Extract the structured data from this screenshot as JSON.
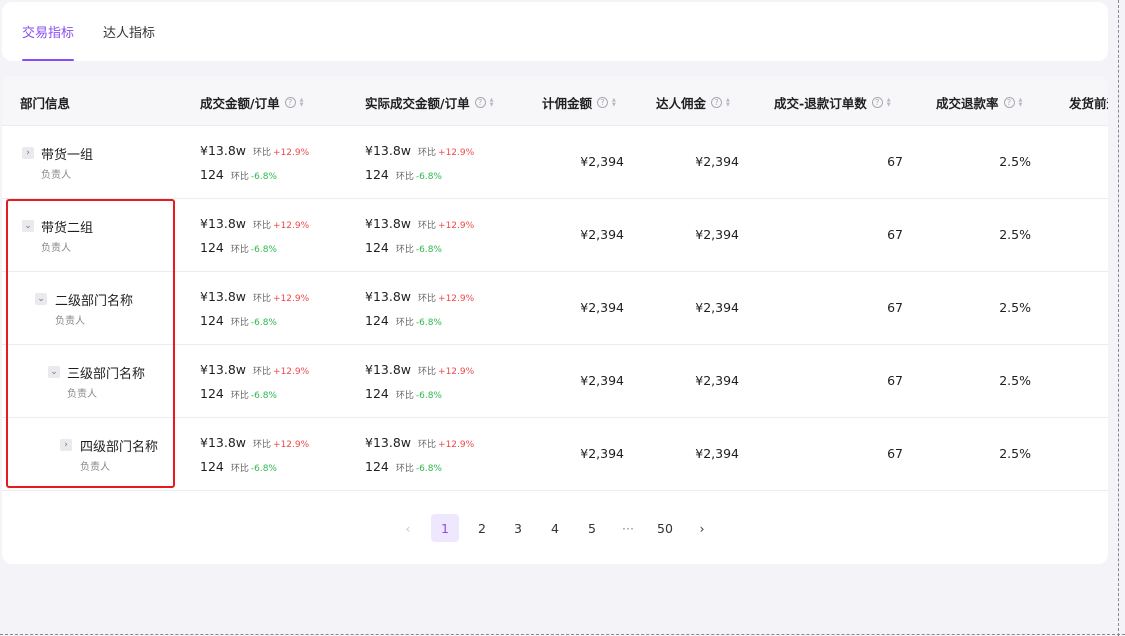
{
  "tabs": [
    {
      "label": "交易指标",
      "active": true
    },
    {
      "label": "达人指标",
      "active": false
    }
  ],
  "colors": {
    "accent": "#8a4df0",
    "up": "#f04848",
    "down": "#2db84d",
    "highlight": "#e8191f"
  },
  "columns": {
    "dept": "部门信息",
    "gmv_orders": "成交金额/订单",
    "actual_gmv_orders": "实际成交金额/订单",
    "commission_base": "计佣金额",
    "creator_commission": "达人佣金",
    "net_orders": "成交-退款订单数",
    "refund_rate": "成交退款率",
    "pre_ship_refund": "发货前退款"
  },
  "compare_label": "环比",
  "rows": [
    {
      "name": "带货一组",
      "owner": "负责人",
      "expander": "›",
      "gmv": "¥13.8w",
      "gmv_change": "+12.9%",
      "orders": "124",
      "orders_change": "-6.8%",
      "actual_gmv": "¥13.8w",
      "actual_gmv_change": "+12.9%",
      "actual_orders": "124",
      "actual_orders_change": "-6.8%",
      "commission_base": "¥2,394",
      "creator_commission": "¥2,394",
      "net_orders": "67",
      "refund_rate": "2.5%"
    },
    {
      "name": "带货二组",
      "owner": "负责人",
      "expander": "⌄",
      "gmv": "¥13.8w",
      "gmv_change": "+12.9%",
      "orders": "124",
      "orders_change": "-6.8%",
      "actual_gmv": "¥13.8w",
      "actual_gmv_change": "+12.9%",
      "actual_orders": "124",
      "actual_orders_change": "-6.8%",
      "commission_base": "¥2,394",
      "creator_commission": "¥2,394",
      "net_orders": "67",
      "refund_rate": "2.5%"
    },
    {
      "name": "二级部门名称",
      "owner": "负责人",
      "expander": "⌄",
      "gmv": "¥13.8w",
      "gmv_change": "+12.9%",
      "orders": "124",
      "orders_change": "-6.8%",
      "actual_gmv": "¥13.8w",
      "actual_gmv_change": "+12.9%",
      "actual_orders": "124",
      "actual_orders_change": "-6.8%",
      "commission_base": "¥2,394",
      "creator_commission": "¥2,394",
      "net_orders": "67",
      "refund_rate": "2.5%"
    },
    {
      "name": "三级部门名称",
      "owner": "负责人",
      "expander": "⌄",
      "gmv": "¥13.8w",
      "gmv_change": "+12.9%",
      "orders": "124",
      "orders_change": "-6.8%",
      "actual_gmv": "¥13.8w",
      "actual_gmv_change": "+12.9%",
      "actual_orders": "124",
      "actual_orders_change": "-6.8%",
      "commission_base": "¥2,394",
      "creator_commission": "¥2,394",
      "net_orders": "67",
      "refund_rate": "2.5%"
    },
    {
      "name": "四级部门名称",
      "owner": "负责人",
      "expander": "›",
      "gmv": "¥13.8w",
      "gmv_change": "+12.9%",
      "orders": "124",
      "orders_change": "-6.8%",
      "actual_gmv": "¥13.8w",
      "actual_gmv_change": "+12.9%",
      "actual_orders": "124",
      "actual_orders_change": "-6.8%",
      "commission_base": "¥2,394",
      "creator_commission": "¥2,394",
      "net_orders": "67",
      "refund_rate": "2.5%"
    }
  ],
  "pagination": {
    "prev": "‹",
    "pages": [
      "1",
      "2",
      "3",
      "4",
      "5",
      "···",
      "50"
    ],
    "current": "1",
    "next": "›"
  }
}
